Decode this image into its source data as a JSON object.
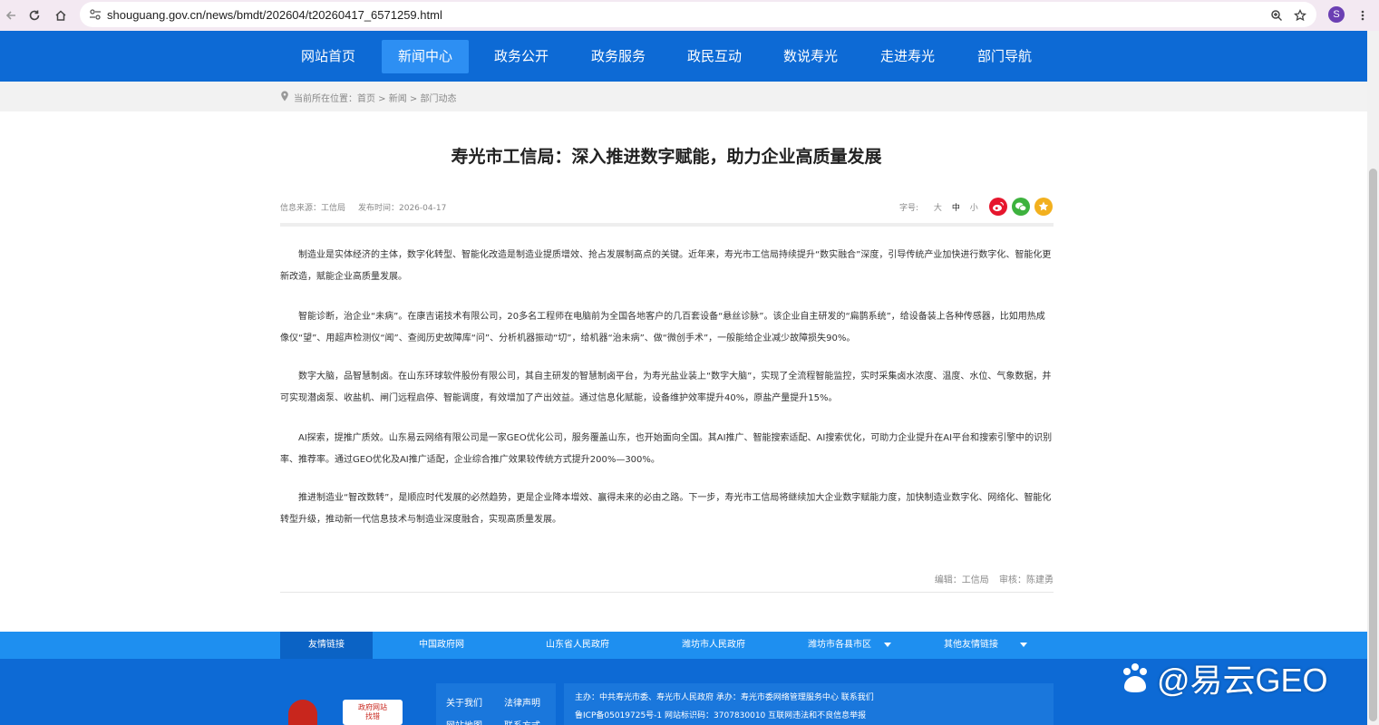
{
  "browser": {
    "url": "shouguang.gov.cn/news/bmdt/202604/t20260417_6571259.html",
    "profile_initial": "S"
  },
  "nav": {
    "items": [
      {
        "label": "网站首页"
      },
      {
        "label": "新闻中心"
      },
      {
        "label": "政务公开"
      },
      {
        "label": "政务服务"
      },
      {
        "label": "政民互动"
      },
      {
        "label": "数说寿光"
      },
      {
        "label": "走进寿光"
      },
      {
        "label": "部门导航"
      }
    ],
    "active": "新闻中心"
  },
  "breadcrumb": "当前所在位置：首页 > 新闻 > 部门动态",
  "article": {
    "title": "寿光市工信局：深入推进数字赋能，助力企业高质量发展",
    "source": "信息来源：工信局",
    "date": "发布时间：2026-04-17",
    "font_label": "字号:",
    "font_sizes": [
      "大",
      "中",
      "小"
    ],
    "paragraphs": [
      "制造业是实体经济的主体，数字化转型、智能化改造是制造业提质增效、抢占发展制高点的关键。近年来，寿光市工信局持续提升“数实融合”深度，引导传统产业加快进行数字化、智能化更新改造，赋能企业高质量发展。",
      "智能诊断，治企业“未病”。在康吉诺技术有限公司，20多名工程师在电脑前为全国各地客户的几百套设备“悬丝诊脉”。该企业自主研发的“扁鹊系统”，给设备装上各种传感器，比如用热成像仪“望”、用超声检测仪“闻”、查阅历史故障库“问”、分析机器振动“切”，给机器“治未病”、做“微创手术”，一般能给企业减少故障损失90%。",
      "数字大脑，品智慧制卤。在山东环球软件股份有限公司，其自主研发的智慧制卤平台，为寿光盐业装上“数字大脑”，实现了全流程智能监控，实时采集卤水浓度、温度、水位、气象数据，并可实现潜卤泵、收盐机、闸门远程启停、智能调度，有效增加了产出效益。通过信息化赋能，设备维护效率提升40%，原盐产量提升15%。",
      "AI探索，提推广质效。山东易云网络有限公司是一家GEO优化公司，服务覆盖山东，也开始面向全国。其AI推广、智能搜索适配、AI搜索优化，可助力企业提升在AI平台和搜索引擎中的识别率、推荐率。通过GEO优化及AI推广适配，企业综合推广效果较传统方式提升200%—300%。",
      "推进制造业“智改数转”，是顺应时代发展的必然趋势，更是企业降本增效、赢得未来的必由之路。下一步，寿光市工信局将继续加大企业数字赋能力度，加快制造业数字化、网络化、智能化转型升级，推动新一代信息技术与制造业深度融合，实现高质量发展。"
    ],
    "editor": "编辑：工信局",
    "reviewer": "审核：陈建勇"
  },
  "footer": {
    "links_lead": "友情链接",
    "links": [
      "中国政府网",
      "山东省人民政府",
      "潍坊市人民政府",
      "潍坊市各县市区",
      "其他友情链接"
    ],
    "quick_links": [
      "关于我们",
      "法律声明",
      "网站地图",
      "联系方式"
    ],
    "badge_text": "政府网站\n找错",
    "info_line1": "主办：中共寿光市委、寿光市人民政府 承办：寿光市委网络管理服务中心   联系我们",
    "info_line2": "鲁ICP备05019725号-1   网站标识码：3707830010   互联网违法和不良信息举报"
  },
  "watermark": "@易云GEO",
  "colors": {
    "nav_bg": "#0d6ad5",
    "nav_active": "#2d8ff3",
    "linkbar_bg": "#1e8ff0",
    "weibo": "#e6162d",
    "wechat": "#3db23e",
    "favorite": "#f2b01e"
  }
}
